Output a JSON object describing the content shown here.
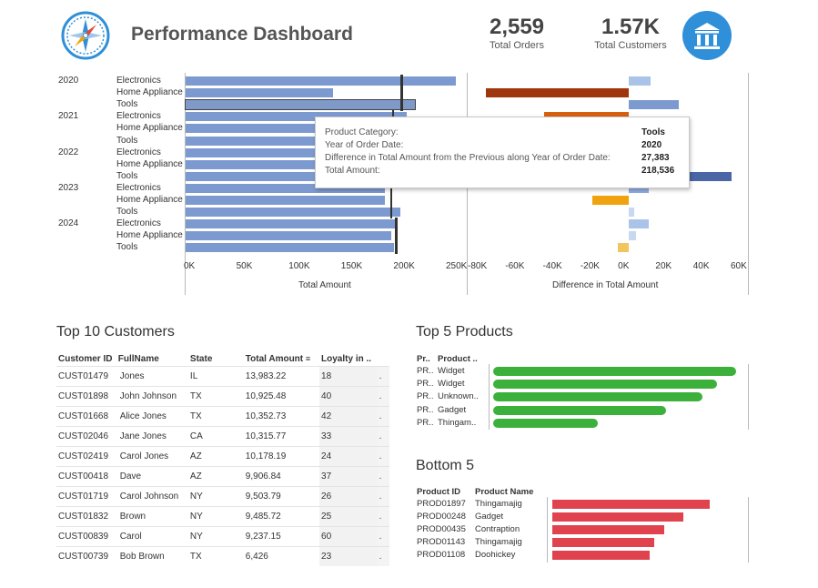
{
  "header": {
    "title": "Performance Dashboard",
    "kpis": [
      {
        "value": "2,559",
        "label": "Total Orders"
      },
      {
        "value": "1.57K",
        "label": "Total Customers"
      }
    ],
    "icons": {
      "logo": "compass-icon",
      "bank": "bank-icon"
    }
  },
  "chart_data": [
    {
      "type": "bar",
      "orientation": "horizontal",
      "xlabel": "Total Amount",
      "ylim_ticks": [
        "0K",
        "50K",
        "100K",
        "150K",
        "200K",
        "250K"
      ],
      "xlim": [
        0,
        260000
      ],
      "rows": [
        {
          "year": "2020",
          "category": "Electronics",
          "value": 258000,
          "ref": 205000
        },
        {
          "year": "",
          "category": "Home Appliance",
          "value": 141000,
          "ref": 205000
        },
        {
          "year": "",
          "category": "Tools",
          "value": 218536,
          "ref": 205000,
          "highlight": true
        },
        {
          "year": "2021",
          "category": "Electronics",
          "value": 211000,
          "ref": 197000
        },
        {
          "year": "",
          "category": "Home Appliance",
          "value": 168000,
          "ref": 197000
        },
        {
          "year": "",
          "category": "Tools",
          "value": 190000,
          "ref": 197000
        },
        {
          "year": "2022",
          "category": "Electronics",
          "value": 198000,
          "ref": 198000
        },
        {
          "year": "",
          "category": "Home Appliance",
          "value": 200000,
          "ref": 198000
        },
        {
          "year": "",
          "category": "Tools",
          "value": 196000,
          "ref": 198000
        },
        {
          "year": "2023",
          "category": "Electronics",
          "value": 190000,
          "ref": 195000
        },
        {
          "year": "",
          "category": "Home Appliance",
          "value": 190000,
          "ref": 195000
        },
        {
          "year": "",
          "category": "Tools",
          "value": 205000,
          "ref": 195000
        },
        {
          "year": "2024",
          "category": "Electronics",
          "value": 201000,
          "ref": 200000
        },
        {
          "year": "",
          "category": "Home Appliance",
          "value": 196000,
          "ref": 200000
        },
        {
          "year": "",
          "category": "Tools",
          "value": 199000,
          "ref": 200000
        }
      ]
    },
    {
      "type": "bar",
      "orientation": "horizontal",
      "xlabel": "Difference in Total Amount",
      "ticks": [
        "-80K",
        "-60K",
        "-40K",
        "-20K",
        "0K",
        "20K",
        "40K",
        "60K"
      ],
      "xlim": [
        -80000,
        60000
      ],
      "values": [
        12000,
        -78000,
        27383,
        -46000,
        null,
        8000,
        -10000,
        2000,
        56000,
        11000,
        -20000,
        3000,
        11000,
        4000,
        -6000
      ],
      "colors": [
        "#a9c4e8",
        "#a0360d",
        "#7d9ad0",
        "#d65f10",
        "#ffffff",
        "#bcd0ee",
        "#c2ccdf",
        "#ffffff",
        "#4a66a6",
        "#8faee0",
        "#f0a30e",
        "#c7d8f0",
        "#a9c4e8",
        "#c7d8f0",
        "#f2c65f"
      ]
    }
  ],
  "tooltip": {
    "rows": [
      {
        "key": "Product Category:",
        "value": "Tools"
      },
      {
        "key": "Year of Order Date:",
        "value": "2020"
      },
      {
        "key": "Difference in Total Amount from the Previous along Year of Order Date:",
        "value": "27,383"
      },
      {
        "key": "Total Amount:",
        "value": "218,536"
      }
    ]
  },
  "customers": {
    "title": "Top 10 Customers",
    "columns": [
      "Customer ID",
      "FullName",
      "State",
      "Total Amount",
      "Loyalty in .."
    ],
    "rows": [
      [
        "CUST01479",
        "Jones",
        "IL",
        "13,983.22",
        "18"
      ],
      [
        "CUST01898",
        "John Johnson",
        "TX",
        "10,925.48",
        "40"
      ],
      [
        "CUST01668",
        "Alice Jones",
        "TX",
        "10,352.73",
        "42"
      ],
      [
        "CUST02046",
        "Jane Jones",
        "CA",
        "10,315.77",
        "33"
      ],
      [
        "CUST02419",
        "Carol Jones",
        "AZ",
        "10,178.19",
        "24"
      ],
      [
        "CUST00418",
        "Dave",
        "AZ",
        "9,906.84",
        "37"
      ],
      [
        "CUST01719",
        "Carol Johnson",
        "NY",
        "9,503.79",
        "26"
      ],
      [
        "CUST01832",
        "Brown",
        "NY",
        "9,485.72",
        "25"
      ],
      [
        "CUST00839",
        "Carol",
        "NY",
        "9,237.15",
        "60"
      ],
      [
        "CUST00739",
        "Bob Brown",
        "TX",
        "6,426",
        "23"
      ]
    ]
  },
  "top_products": {
    "title": "Top 5 Products",
    "col1": "Pr..",
    "col2": "Product ..",
    "rows": [
      {
        "id": "PR..",
        "name": "Widget",
        "value": 1.0
      },
      {
        "id": "PR..",
        "name": "Widget",
        "value": 0.92
      },
      {
        "id": "PR..",
        "name": "Unknown..",
        "value": 0.86
      },
      {
        "id": "PR..",
        "name": "Gadget",
        "value": 0.71
      },
      {
        "id": "PR..",
        "name": "Thingam..",
        "value": 0.43
      }
    ]
  },
  "bottom_products": {
    "title": "Bottom 5",
    "col1": "Product ID",
    "col2": "Product Name",
    "rows": [
      {
        "id": "PROD01897",
        "name": "Thingamajig",
        "value": 1.0
      },
      {
        "id": "PROD00248",
        "name": "Gadget",
        "value": 0.83
      },
      {
        "id": "PROD00435",
        "name": "Contraption",
        "value": 0.71
      },
      {
        "id": "PROD01143",
        "name": "Thingamajig",
        "value": 0.65
      },
      {
        "id": "PROD01108",
        "name": "Doohickey",
        "value": 0.62
      }
    ]
  }
}
